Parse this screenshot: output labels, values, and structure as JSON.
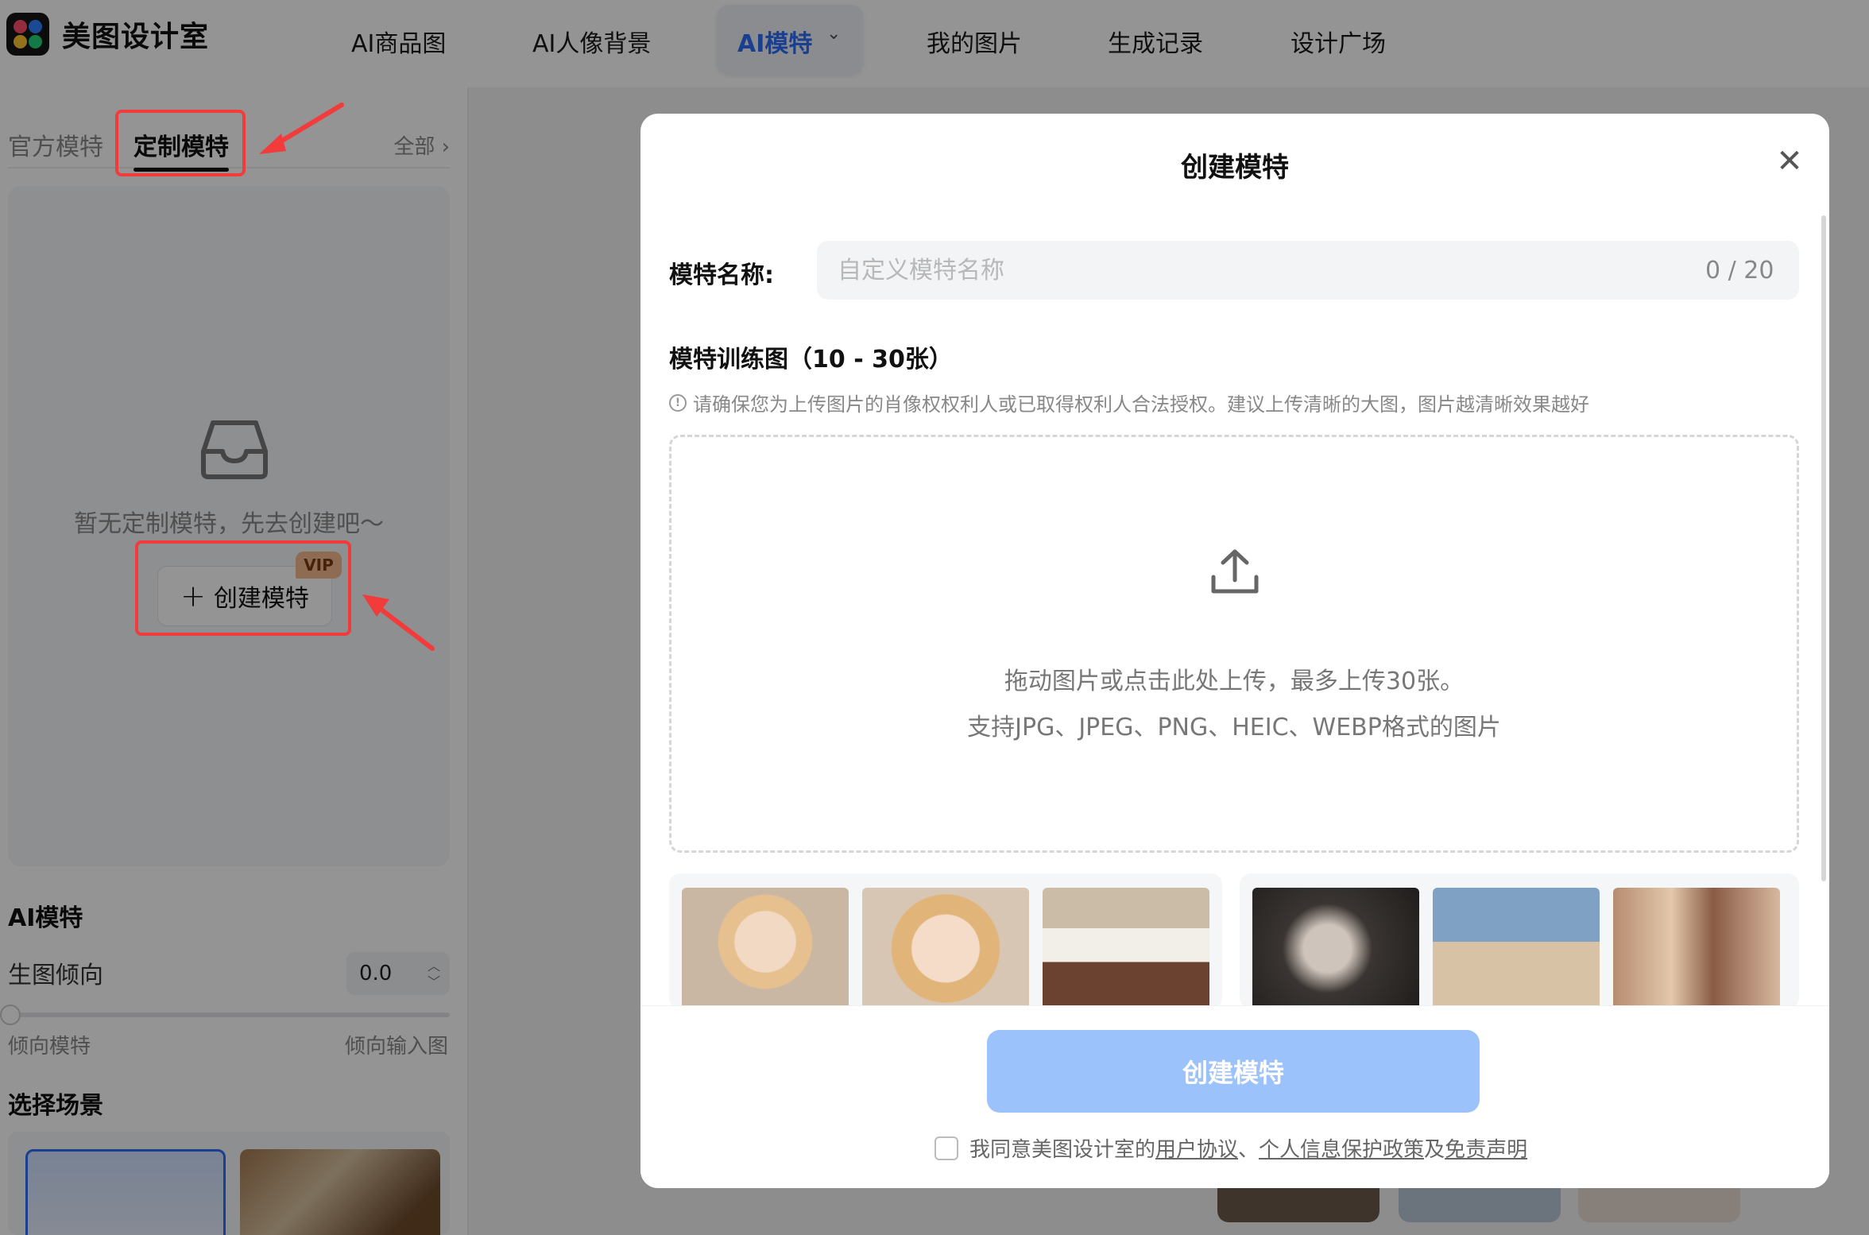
{
  "app": {
    "name": "美图设计室"
  },
  "nav": {
    "items": [
      "AI商品图",
      "AI人像背景",
      "我的图片",
      "生成记录",
      "设计广场"
    ],
    "active": "AI模特"
  },
  "sidebar": {
    "tabs": [
      "官方模特",
      "定制模特"
    ],
    "all_link": "全部 ›",
    "empty_text": "暂无定制模特，先去创建吧～",
    "create_button": "创建模特",
    "vip_badge": "VIP",
    "section_ai_model": "AI模特",
    "slider_label": "生图倾向",
    "slider_value": "0.0",
    "slider_left": "倾向模特",
    "slider_right": "倾向输入图",
    "section_scene": "选择场景"
  },
  "modal": {
    "title": "创建模特",
    "close": "✕",
    "name_label": "模特名称:",
    "name_placeholder": "自定义模特名称",
    "name_value": "",
    "name_counter": "0 / 20",
    "train_title": "模特训练图（10 - 30张）",
    "hint": "请确保您为上传图片的肖像权权利人或已取得权利人合法授权。建议上传清晰的大图，图片越清晰效果越好",
    "drop_line1": "拖动图片或点击此处上传，最多上传30张。",
    "drop_line2": "支持JPG、JPEG、PNG、HEIC、WEBP格式的图片",
    "submit": "创建模特",
    "agree_prefix": "我同意美图设计室的",
    "agree_link1": "用户协议",
    "agree_sep": "、",
    "agree_link2": "个人信息保护政策",
    "agree_and": "及",
    "agree_link3": "免责声明",
    "agree_checked": false
  },
  "colors": {
    "accent": "#2f6df6",
    "submit_disabled": "#9cc2fb",
    "annotation": "#f23c3c",
    "vip": "#f4b98f"
  }
}
